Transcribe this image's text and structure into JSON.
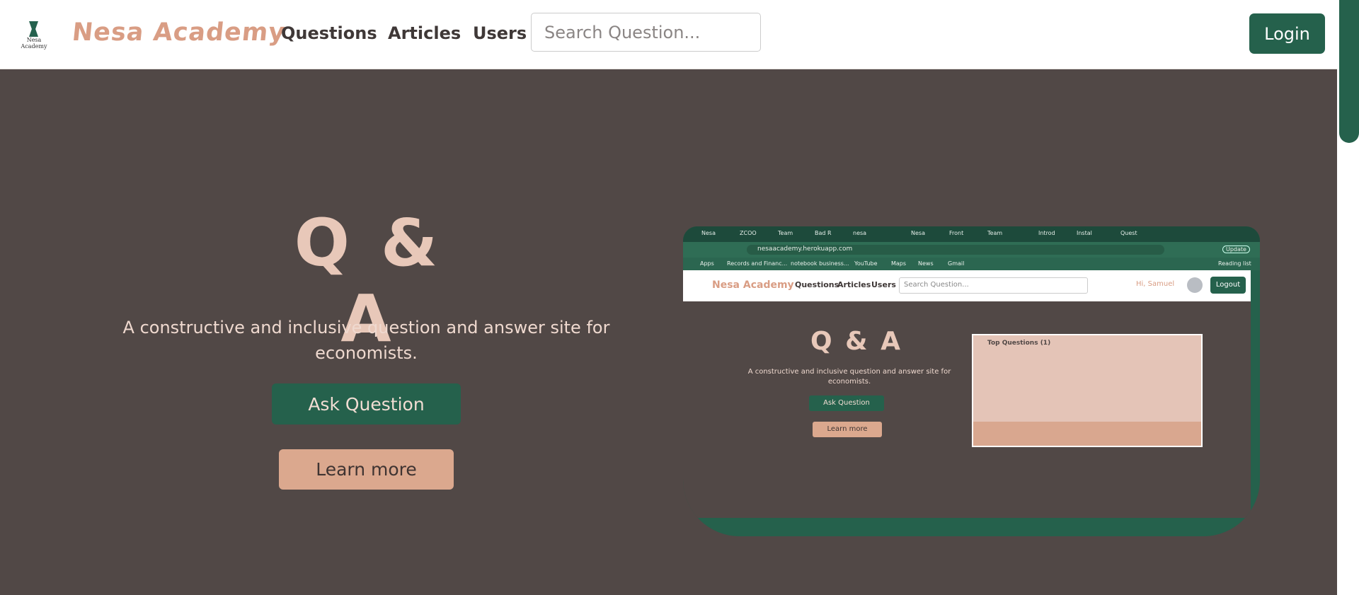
{
  "navbar": {
    "logo_caption": "Nesa Academy",
    "brand": "Nesa Academy",
    "links": [
      "Questions",
      "Articles",
      "Users"
    ],
    "search_placeholder": "Search Question...",
    "login_label": "Login"
  },
  "hero": {
    "title": "Q & A",
    "subtitle": "A constructive and inclusive question and answer site for economists.",
    "ask_label": "Ask Question",
    "learn_label": "Learn more"
  },
  "preview": {
    "tabs": [
      "Nesa",
      "ZCOO",
      "Team",
      "Bad R",
      "nesa",
      "Nesa",
      "Front",
      "Team",
      "Introd",
      "Instal",
      "Quest"
    ],
    "url": "nesaacademy.herokuapp.com",
    "update_label": "Update",
    "bookmarks": [
      "Apps",
      "Records and Financ...",
      "notebook business...",
      "YouTube",
      "Maps",
      "News",
      "Gmail",
      "Reading list"
    ],
    "brand": "Nesa Academy",
    "links": [
      "Questions",
      "Articles",
      "Users"
    ],
    "search_placeholder": "Search Question...",
    "user_label": "Hi, Samuel",
    "logout_label": "Logout",
    "title": "Q & A",
    "subtitle": "A constructive and inclusive question and answer site for economists.",
    "ask_label": "Ask Question",
    "learn_label": "Learn more",
    "card_title": "Top Questions (1)"
  },
  "colors": {
    "primary": "#25614c",
    "accent": "#d99d84",
    "background": "#514846"
  }
}
